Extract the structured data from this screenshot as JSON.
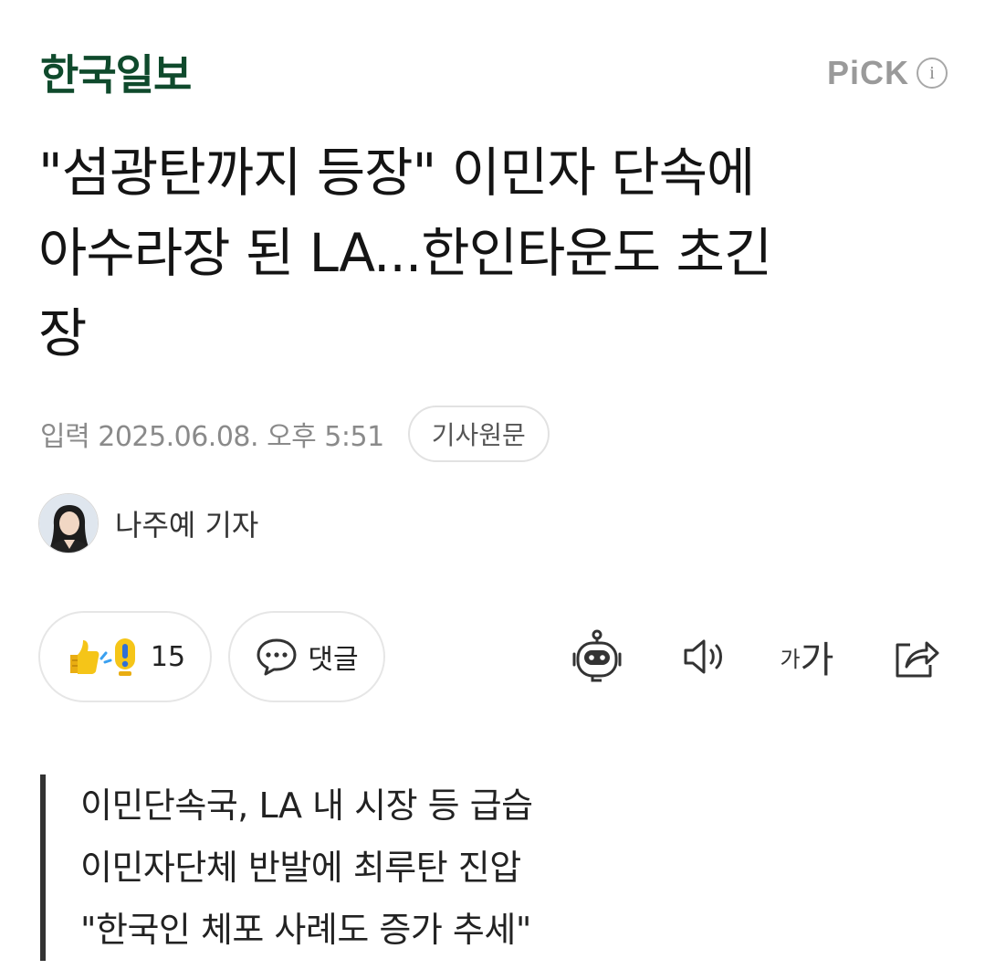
{
  "header": {
    "brand": "한국일보",
    "pick_label": "PiCK",
    "pick_info": "i"
  },
  "article": {
    "headline_lines": [
      "\"섬광탄까지 등장\" 이민자 단속에",
      "아수라장 된 LA...한인타운도 초긴",
      "장"
    ],
    "published": "입력 2025.06.08. 오후 5:51",
    "original_button": "기사원문",
    "reporter": "나주예 기자",
    "summary_lines": [
      "이민단속국, LA 내 시장 등 급습",
      "이민자단체 반발에 최루탄 진압",
      "\"한국인 체포 사례도 증가 추세\""
    ]
  },
  "actions": {
    "reaction_count": "15",
    "comment_label": "댓글",
    "font_small": "가",
    "font_large": "가",
    "tools": [
      "robot-summary-icon",
      "speaker-icon",
      "font-size-icon",
      "share-icon"
    ]
  },
  "colors": {
    "brand": "#0f4a2c",
    "muted": "#8a8a8a",
    "pill_border": "#e6e6e6",
    "emoji_yellow": "#f5c518",
    "emoji_blue": "#3aa0f0"
  }
}
